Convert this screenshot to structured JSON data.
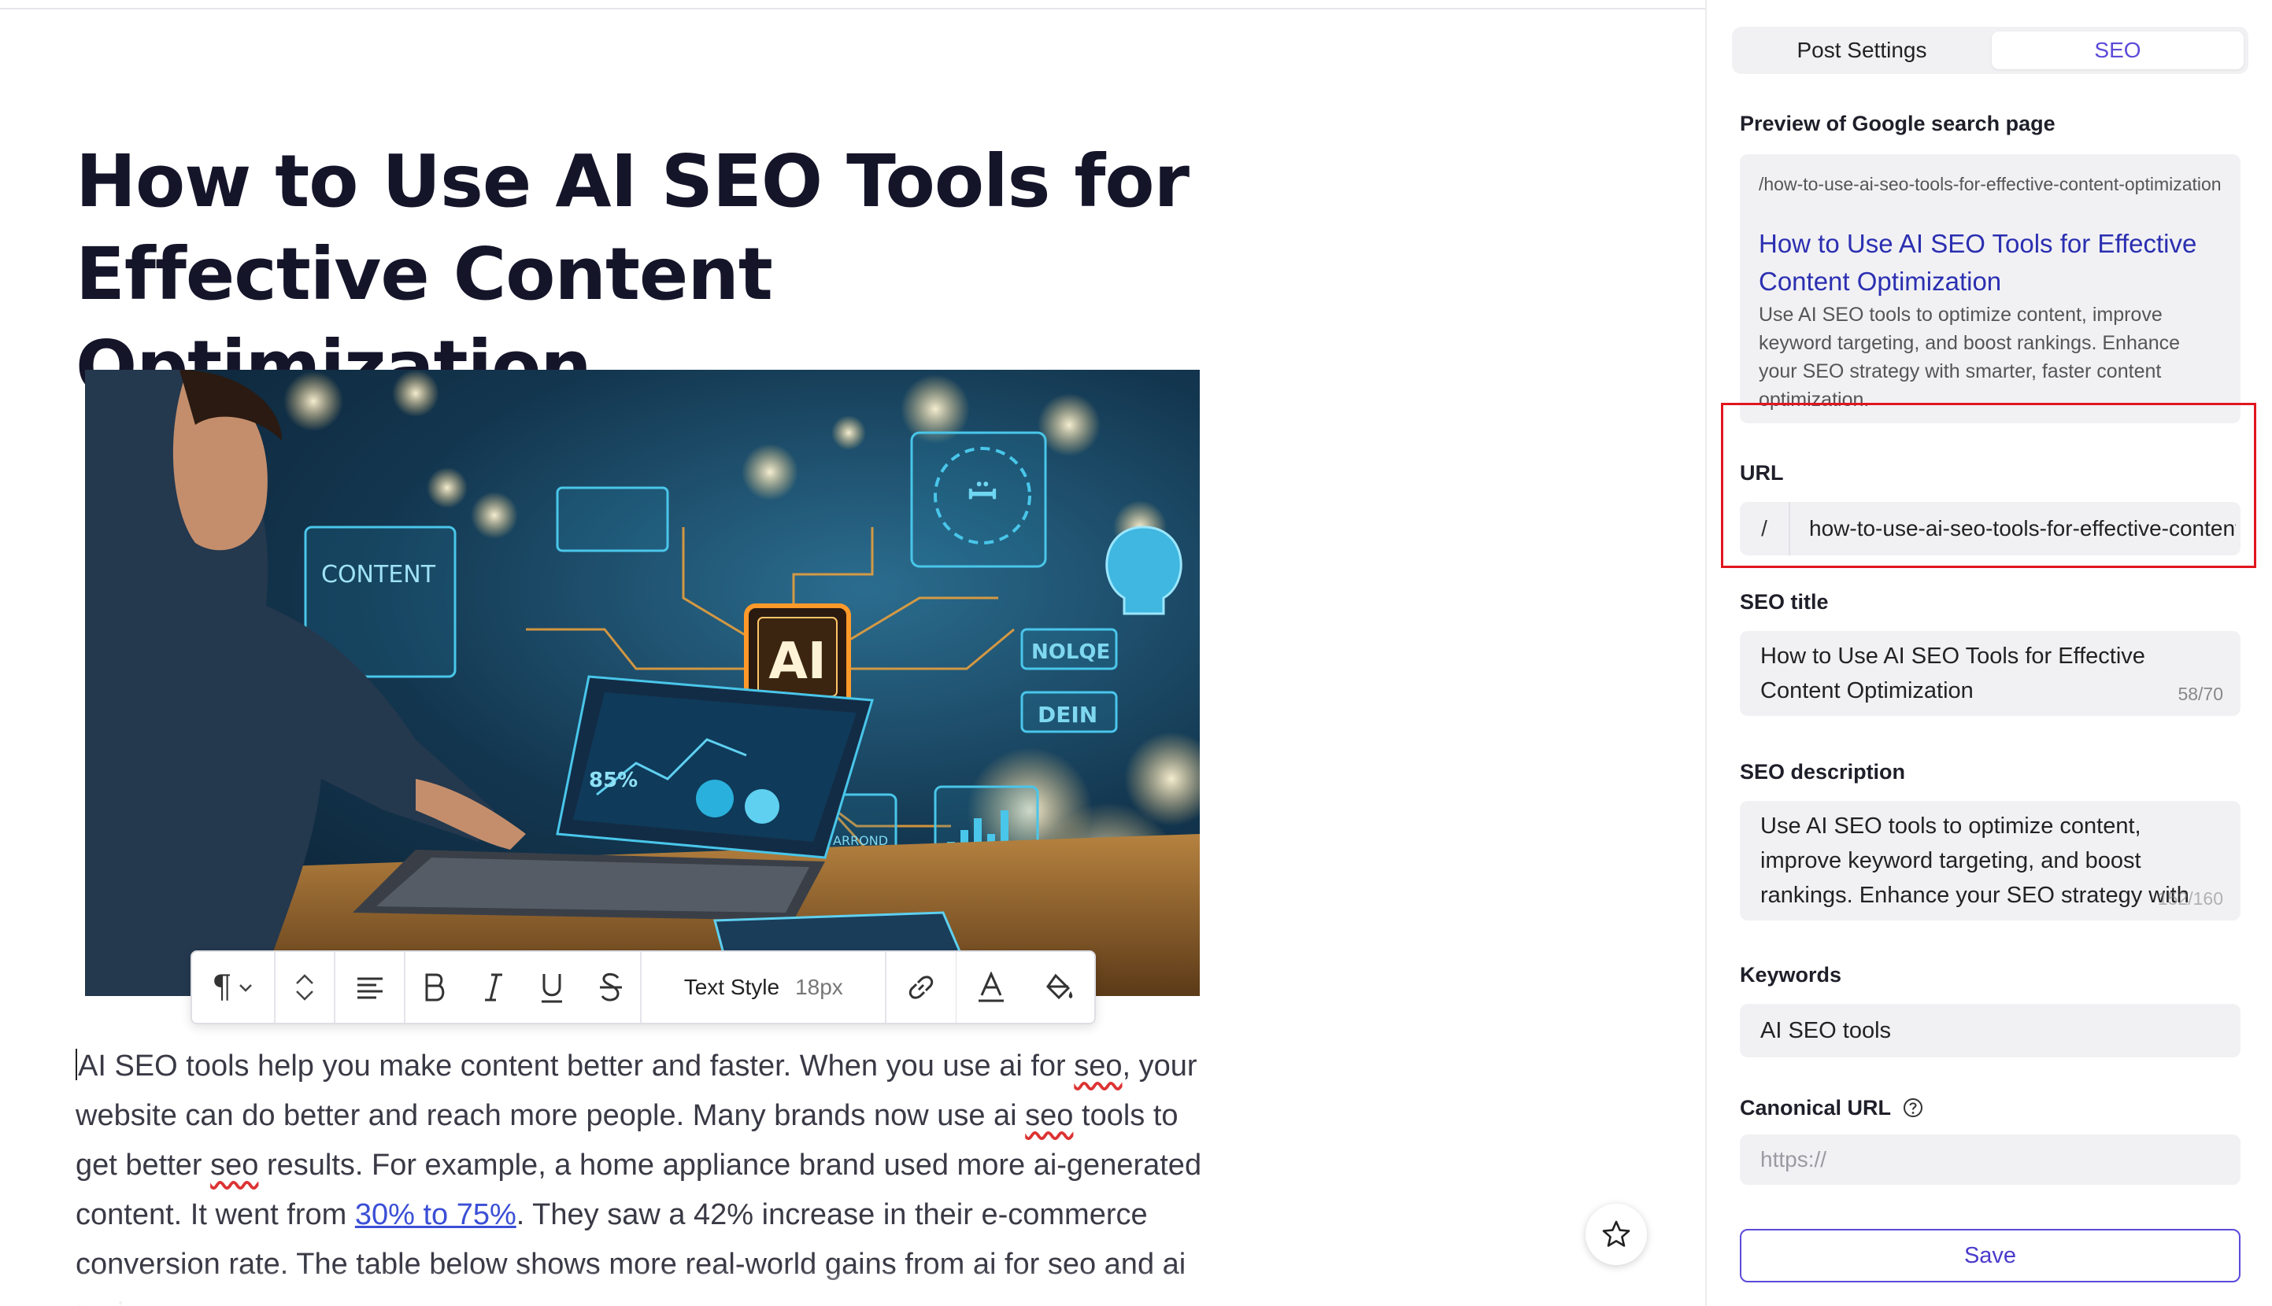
{
  "post": {
    "title": "How to Use AI SEO Tools for Effective Content Optimization",
    "hero_text": {
      "content": "CONTENT",
      "ai": "AI",
      "nolde": "NOLQE",
      "dein": "DEIN",
      "arrond": "ARROND",
      "stat": "85%"
    },
    "body": {
      "p1": "AI SEO tools help you make content better and faster. When you use ai for ",
      "w_seo1": "seo",
      "p2": ", your website can do better and reach more people. Many brands now use ai ",
      "w_seo2": "seo",
      "p3": " tools to get better ",
      "w_seo3": "seo",
      "p4": " results. For example, a home appliance brand used more ai-generated content. It went from ",
      "link": "30% to 75%",
      "p5": ". They saw a 42% increase in their e-commerce conversion rate. The table below shows more real-world gains from ai for seo and ai tools:"
    }
  },
  "toolbar": {
    "paragraph_icon": "paragraph-icon",
    "text_style_label": "Text Style",
    "font_size": "18px"
  },
  "panel": {
    "tabs": [
      "Post Settings",
      "SEO"
    ],
    "active_tab": "SEO",
    "preview": {
      "heading": "Preview of Google search page",
      "url": "/how-to-use-ai-seo-tools-for-effective-content-optimization",
      "title": "How to Use AI SEO Tools for Effective Content Optimization",
      "description": "Use AI SEO tools to optimize content, improve keyword targeting, and boost rankings. Enhance your SEO strategy with smarter, faster content optimization."
    },
    "url_field": {
      "label": "URL",
      "prefix": "/",
      "value": "how-to-use-ai-seo-tools-for-effective-content-optimization"
    },
    "seo_title": {
      "label": "SEO title",
      "value": "How to Use AI SEO Tools for Effective Content Optimization",
      "counter": "58/70"
    },
    "seo_description": {
      "label": "SEO description",
      "value": "Use AI SEO tools to optimize content, improve keyword targeting, and boost rankings. Enhance your SEO strategy with smarter, faster",
      "counter": "152/160"
    },
    "keywords": {
      "label": "Keywords",
      "value": "AI SEO tools"
    },
    "canonical": {
      "label": "Canonical URL",
      "placeholder": "https://"
    },
    "save_label": "Save"
  },
  "colors": {
    "accent": "#5b4bd9",
    "highlight": "#e1161e",
    "link": "#3b4fd6"
  }
}
